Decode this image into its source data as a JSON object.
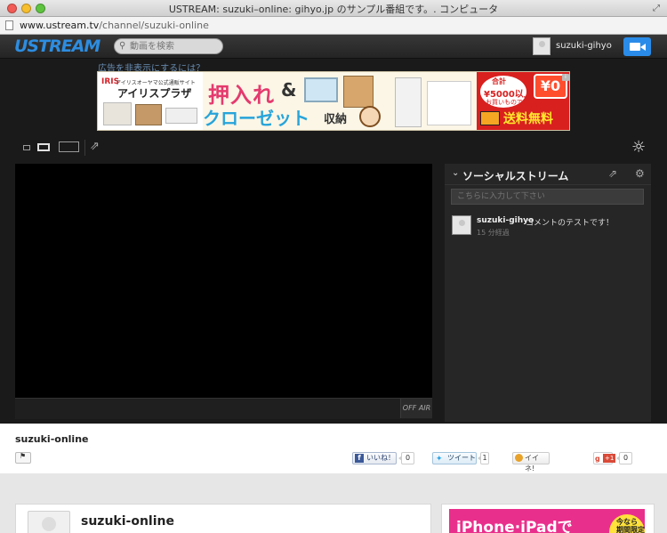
{
  "window": {
    "title": "USTREAM: suzuki–online: gihyo.jp のサンプル番組です。. コンピュータ",
    "url_host": "www.ustream.tv",
    "url_path": "/channel/suzuki-online"
  },
  "header": {
    "logo": "USTREAM",
    "search_placeholder": "動画を検索",
    "username": "suzuki-gihyo"
  },
  "ad": {
    "hide_link": "広告を非表示にするには？",
    "banner": {
      "brand_mark": "IRIS",
      "brand_sub": "アイリスオーヤマ公式通販サイト",
      "brand_name": "アイリスプラザ",
      "headline1": "押入れ",
      "amp": "&",
      "headline2": "クローゼット",
      "headline2_suffix": "収納",
      "total_label": "合計",
      "price_line": "¥5000以上の",
      "purchase_line": "お買いもので!",
      "zero_badge": "¥0",
      "free_shipping": "送料無料",
      "info_glyph": "i"
    }
  },
  "video": {
    "offair_label": "OFF AIR"
  },
  "social": {
    "title": "ソーシャルストリーム",
    "input_placeholder": "こちらに入力して下さい",
    "comments": [
      {
        "user": "suzuki-gihyo",
        "text": "コメントのテストです！",
        "time": "15 分経過"
      }
    ]
  },
  "channel": {
    "name": "suzuki-online",
    "share": {
      "facebook_label": "いいね！",
      "facebook_count": "0",
      "twitter_label": "ツイート",
      "twitter_count": "1",
      "mixi_label": "イイネ!",
      "gplus_label": "+1",
      "gplus_count": "0"
    }
  },
  "lower": {
    "card_title": "suzuki-online",
    "promo_text": "iPhone·iPadで",
    "promo_badge": "今なら 期間限定"
  },
  "colors": {
    "ustream_blue": "#2d8de0",
    "cam_button": "#2a8ce8",
    "banner_pink": "#e43a6e",
    "banner_cyan": "#27a4da",
    "promo_magenta": "#e92f8c"
  }
}
